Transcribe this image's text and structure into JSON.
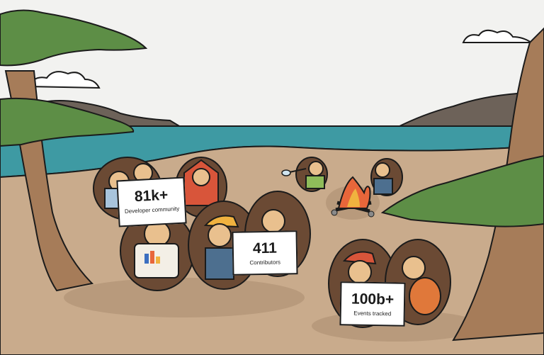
{
  "stats": [
    {
      "value": "81k+",
      "label": "Developer community"
    },
    {
      "value": "411",
      "label": "Contributors"
    },
    {
      "value": "100b+",
      "label": "Events tracked"
    }
  ],
  "colors": {
    "sky": "#f2f2f0",
    "sea": "#3e9aa3",
    "sand": "#c9ab8c",
    "hill": "#6d6259",
    "foliage": "#5d8e46",
    "trunk": "#a67c59",
    "quill": "#6b4a34",
    "face": "#e9c08e",
    "outline": "#1b1b1b"
  }
}
